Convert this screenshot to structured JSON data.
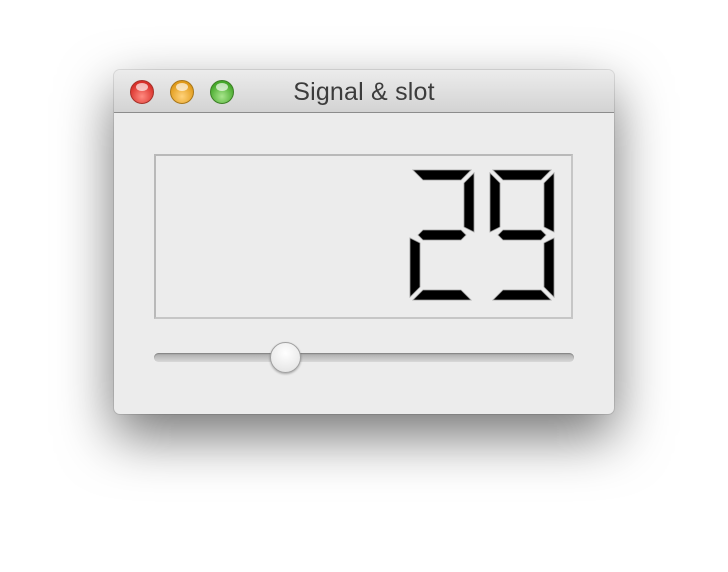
{
  "window": {
    "title": "Signal & slot"
  },
  "lcd": {
    "value": "29"
  },
  "slider": {
    "value": 29,
    "min": 0,
    "max": 99
  },
  "colors": {
    "lcd_digit": "#000000",
    "window_bg": "#ececec"
  }
}
